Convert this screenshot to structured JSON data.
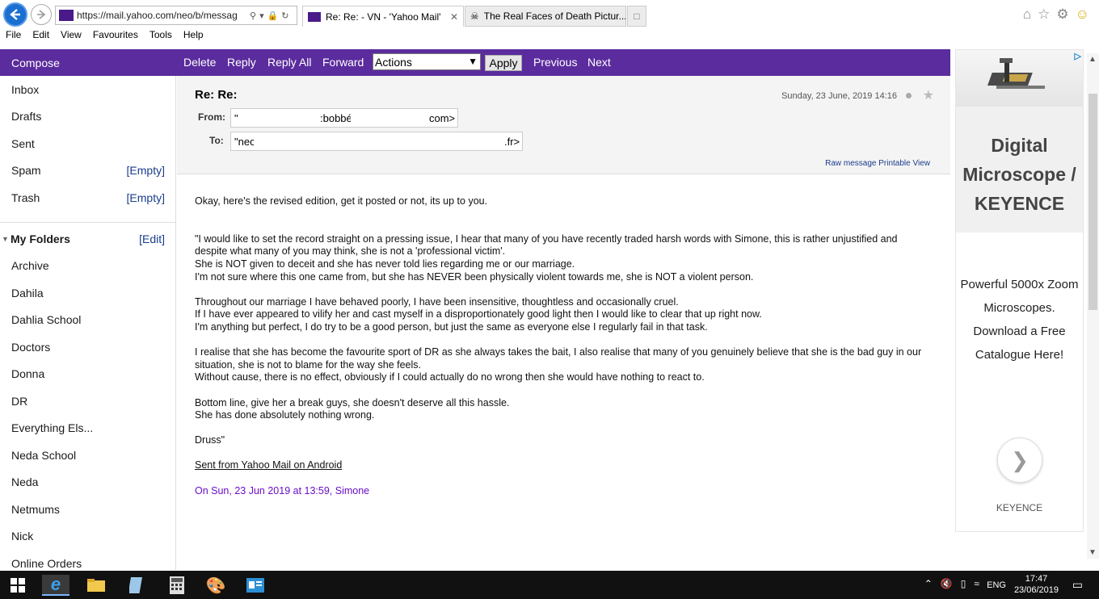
{
  "browser": {
    "url": "https://mail.yahoo.com/neo/b/messag",
    "tabs": [
      {
        "title": "Re: Re: - VN - 'Yahoo Mail'"
      },
      {
        "title": "The Real Faces of Death Pictur..."
      }
    ],
    "menu": [
      "File",
      "Edit",
      "View",
      "Favourites",
      "Tools",
      "Help"
    ]
  },
  "toolbar": {
    "compose": "Compose",
    "delete": "Delete",
    "reply": "Reply",
    "reply_all": "Reply All",
    "forward": "Forward",
    "actions_value": "Actions",
    "apply": "Apply",
    "previous": "Previous",
    "next": "Next",
    "accent": "#5b2c9d"
  },
  "sidebar": {
    "system": [
      {
        "label": "Inbox",
        "extra": ""
      },
      {
        "label": "Drafts",
        "extra": ""
      },
      {
        "label": "Sent",
        "extra": ""
      },
      {
        "label": "Spam",
        "extra": "[Empty]"
      },
      {
        "label": "Trash",
        "extra": "[Empty]"
      }
    ],
    "folders_header": "My Folders",
    "folders_edit": "[Edit]",
    "folders": [
      "Archive",
      "Dahila",
      "Dahlia School",
      "Doctors",
      "Donna",
      "DR",
      "Everything Els...",
      "Neda School",
      "Neda",
      "Netmums",
      "Nick",
      "Online Orders"
    ]
  },
  "message": {
    "subject": "Re: Re:",
    "date": "Sunday, 23 June, 2019 14:16",
    "from_label": "From:",
    "from_value_start": "\"",
    "from_value_mid": ":bobbé",
    "from_value_end": "com>",
    "to_label": "To:",
    "to_value_start": "\"nec",
    "to_value_end": ".fr>",
    "raw_message": "Raw message",
    "printable_view": "Printable View",
    "body": {
      "intro": "Okay, here's the revised edition, get it posted or not, its up to you.",
      "p1": [
        "\"I would like to set the record straight on a pressing issue, I hear that many of you have recently traded harsh words with Simone, this is rather unjustified and despite what many of you may think, she is not a 'professional victim'.",
        "She is NOT given to deceit and she has never told lies regarding me or our marriage.",
        "I'm not sure where this one came from, but she has NEVER been physically violent towards me, she is NOT a violent person."
      ],
      "p2": [
        "Throughout our marriage I have behaved poorly, I have been insensitive, thoughtless and occasionally cruel.",
        "If I have ever appeared to vilify her and cast myself in a disproportionately good light then I would like to clear that up right now.",
        "I'm anything but perfect, I do try to be a good person, but just the same as everyone else I regularly fail in that task."
      ],
      "p3": [
        "I realise that she has become the favourite sport of DR as she always takes the bait, I also realise that many of you genuinely believe that she is the bad guy in our situation, she is not to blame for the way she feels.",
        "Without cause, there is no effect, obviously if I could actually do no wrong then she would have nothing to react to."
      ],
      "p4": [
        "Bottom line, give her a break guys, she doesn't deserve all this hassle.",
        "She has done absolutely nothing wrong."
      ],
      "signoff": "Druss\"",
      "signature": "Sent from Yahoo Mail on Android",
      "quote_header": "On Sun, 23 Jun 2019 at 13:59, Simone"
    }
  },
  "ad": {
    "title": "Digital Microscope / KEYENCE",
    "description": "Powerful 5000x Zoom Microscopes. Download a Free Catalogue Here!",
    "brand": "KEYENCE",
    "cta_icon": "chevron-right-icon"
  },
  "taskbar": {
    "lang": "ENG",
    "time": "17:47",
    "date": "23/06/2019"
  }
}
